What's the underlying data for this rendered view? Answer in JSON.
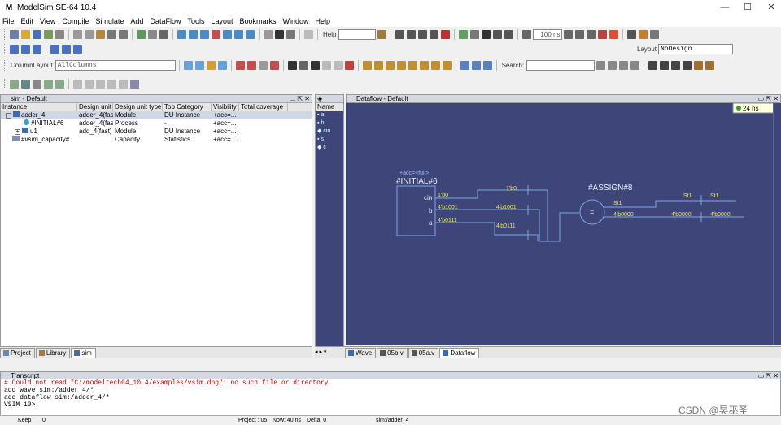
{
  "window": {
    "title": "ModelSim SE-64 10.4",
    "logo": "M",
    "minimize": "—",
    "maximize": "☐",
    "close": "✕"
  },
  "menu": [
    "File",
    "Edit",
    "View",
    "Compile",
    "Simulate",
    "Add",
    "DataFlow",
    "Tools",
    "Layout",
    "Bookmarks",
    "Window",
    "Help"
  ],
  "toolbar": {
    "help_label": "Help",
    "run_length": "100 ns",
    "layout_label": "Layout",
    "layout_value": "NoDesign",
    "column_layout_label": "ColumnLayout",
    "column_layout_value": "AllColumns",
    "search_label": "Search:"
  },
  "sim_panel": {
    "title": "sim - Default",
    "columns": [
      "Instance",
      "Design unit",
      "Design unit type",
      "Top Category",
      "Visibility",
      "Total coverage"
    ],
    "rows": [
      {
        "instance": "adder_4",
        "design_unit": "adder_4(fast)",
        "type": "Module",
        "category": "DU Instance",
        "visibility": "+acc=..."
      },
      {
        "instance": "#INITIAL#6",
        "design_unit": "adder_4(fast)",
        "type": "Process",
        "category": "-",
        "visibility": "+acc=..."
      },
      {
        "instance": "u1",
        "design_unit": "add_4(fast)",
        "type": "Module",
        "category": "DU Instance",
        "visibility": "+acc=..."
      },
      {
        "instance": "#vsim_capacity#",
        "design_unit": "",
        "type": "Capacity",
        "category": "Statistics",
        "visibility": "+acc=..."
      }
    ],
    "tabs": [
      "Project",
      "Library",
      "sim"
    ]
  },
  "objects_panel": {
    "column": "Name",
    "items": [
      "a",
      "b",
      "cin",
      "s",
      "c"
    ]
  },
  "dataflow": {
    "title": "Dataflow - Default",
    "time": "24 ns",
    "initial_block": {
      "acc": "+acc=<full>",
      "name": "#INITIAL#6",
      "ports": [
        "cin",
        "b",
        "a"
      ]
    },
    "assign_block": {
      "name": "#ASSIGN#8",
      "op": "="
    },
    "labels": {
      "cin_val": "1'b0",
      "b_val": "4'b1001",
      "a_val": "4'b0111",
      "cin_mid": "1'b0",
      "b_mid": "4'b1001",
      "a_mid": "4'b0111",
      "st_out1": "St1",
      "st_out2": "St1",
      "st_out3": "St1",
      "sum_out1": "4'b0000",
      "sum_out2": "4'b0000",
      "sum_out3": "4'b0000"
    },
    "tabs": [
      "Wave",
      "05b.v",
      "05a.v",
      "Dataflow"
    ]
  },
  "transcript": {
    "title": "Transcript",
    "lines": [
      "# Could not read \"C:/modeltech64_10.4/examples/vsim.dbg\": no such file or directory",
      "add wave sim:/adder_4/*",
      "add dataflow sim:/adder_4/*",
      "",
      "VSIM 10>"
    ]
  },
  "status": {
    "keep": "Keep",
    "keep_val": "0",
    "project": "Project : 05",
    "now": "Now: 40 ns",
    "delta": "Delta: 0",
    "path": "sim:/adder_4"
  },
  "watermark": "CSDN @昊巫圣",
  "colors": {
    "dataflow_bg": "#3e4679",
    "signal": "#e8e84a",
    "wire": "#7aa8e8",
    "error": "#c00000"
  }
}
